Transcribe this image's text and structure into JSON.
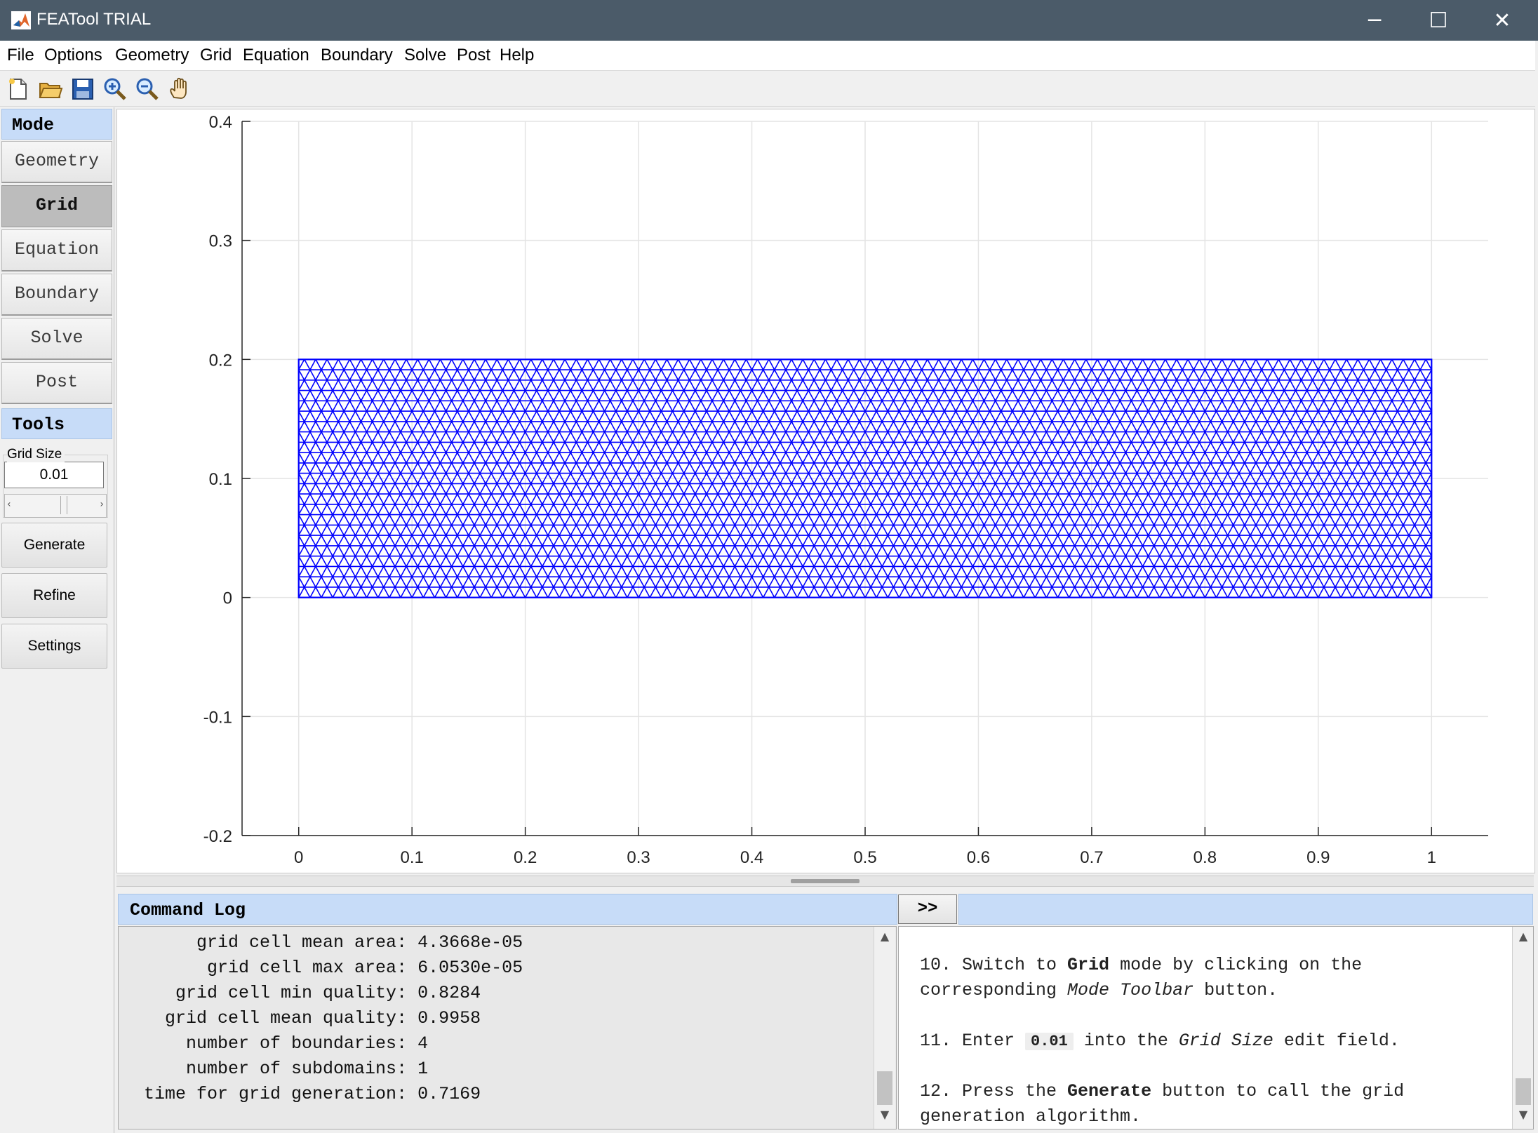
{
  "window": {
    "title": "FEATool TRIAL",
    "controls": [
      "─",
      "☐",
      "✕"
    ]
  },
  "menu": [
    "File",
    "Options",
    "Geometry",
    "Grid",
    "Equation",
    "Boundary",
    "Solve",
    "Post",
    "Help"
  ],
  "toolbar": {
    "icons": [
      "new-file-icon",
      "open-folder-icon",
      "save-icon",
      "zoom-in-icon",
      "zoom-out-icon",
      "pan-hand-icon"
    ]
  },
  "mode_panel": {
    "header": "Mode",
    "buttons": [
      "Geometry",
      "Grid",
      "Equation",
      "Boundary",
      "Solve",
      "Post"
    ],
    "active": "Grid"
  },
  "tools_panel": {
    "header": "Tools",
    "grid_size_label": "Grid Size",
    "grid_size_value": "0.01",
    "slider_left_arrow": "‹",
    "slider_right_arrow": "›",
    "buttons": [
      "Generate",
      "Refine",
      "Settings"
    ]
  },
  "plot": {
    "x_ticks": [
      "0",
      "0.1",
      "0.2",
      "0.3",
      "0.4",
      "0.5",
      "0.6",
      "0.7",
      "0.8",
      "0.9",
      "1"
    ],
    "y_ticks": [
      "0.4",
      "0.3",
      "0.2",
      "0.1",
      "0",
      "-0.1",
      "-0.2"
    ],
    "xlim": [
      -0.05,
      1.05
    ],
    "ylim": [
      -0.2,
      0.4
    ],
    "mesh_domain": {
      "x": [
        0,
        1
      ],
      "y": [
        0,
        0.2
      ]
    },
    "mesh_cell_size": 0.01,
    "mesh_color": "#0000ff",
    "grid": true
  },
  "command_log": {
    "header": "Command Log",
    "expand_button": ">>",
    "lines": [
      "       grid cell mean area: 4.3668e-05",
      "        grid cell max area: 6.0530e-05",
      "     grid cell min quality: 0.8284",
      "    grid cell mean quality: 0.9958",
      "      number of boundaries: 4",
      "      number of subdomains: 1",
      "  time for grid generation: 0.7169"
    ]
  },
  "help": {
    "step10_num": "10. ",
    "step10_a": "Switch to ",
    "step10_b": "Grid",
    "step10_c": " mode by clicking on the",
    "step10_d": "corresponding ",
    "step10_e": "Mode Toolbar",
    "step10_f": " button.",
    "step11_num": "11. ",
    "step11_a": "Enter ",
    "step11_b": "0.01",
    "step11_c": " into the ",
    "step11_d": "Grid Size",
    "step11_e": " edit field.",
    "step12_num": "12. ",
    "step12_a": "Press the ",
    "step12_b": "Generate",
    "step12_c": " button to call the grid",
    "step12_d": "generation algorithm."
  },
  "scroll_arrows": {
    "up": "▲",
    "down": "▼"
  }
}
